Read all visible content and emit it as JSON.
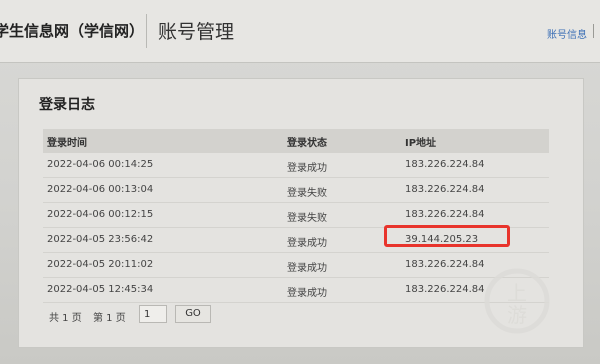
{
  "header": {
    "site_title": "学生信息网（学信网）",
    "page_heading": "账号管理",
    "account_link": "账号信息"
  },
  "login_log": {
    "title": "登录日志",
    "columns": [
      "登录时间",
      "登录状态",
      "IP地址"
    ],
    "rows": [
      {
        "time": "2022-04-06 00:14:25",
        "status": "登录成功",
        "ip": "183.226.224.84"
      },
      {
        "time": "2022-04-06 00:13:04",
        "status": "登录失败",
        "ip": "183.226.224.84"
      },
      {
        "time": "2022-04-06 00:12:15",
        "status": "登录失败",
        "ip": "183.226.224.84"
      },
      {
        "time": "2022-04-05 23:56:42",
        "status": "登录成功",
        "ip": "39.144.205.23"
      },
      {
        "time": "2022-04-05 20:11:02",
        "status": "登录成功",
        "ip": "183.226.224.84"
      },
      {
        "time": "2022-04-05 12:45:34",
        "status": "登录成功",
        "ip": "183.226.224.84"
      }
    ],
    "highlight_color": "#e8342c"
  },
  "pager": {
    "total_pages_text": "共 1 页",
    "current_page_text": "第 1 页",
    "page_input_value": "1",
    "go_label": "GO"
  },
  "watermark": {
    "text": "上游",
    "color": "#d9d8d4"
  }
}
